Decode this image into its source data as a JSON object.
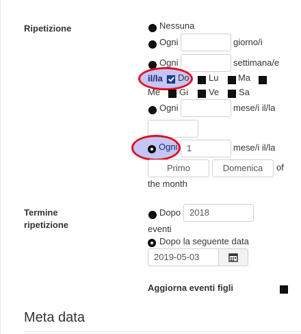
{
  "repeat": {
    "label": "Ripetizione",
    "none": "Nessuna",
    "every": "Ogni",
    "day_unit": "giorno/i",
    "week_unit": "settimana/e",
    "on_the": "il/la",
    "days": [
      "Do",
      "Lu",
      "Ma",
      "Me",
      "Gi",
      "Ve",
      "Sa"
    ],
    "month_unit": "mese/i il/la",
    "month_every_value": "1",
    "month_unit2": "mese/i il/la",
    "ordinal": "Primo",
    "weekday": "Domenica",
    "of": "of",
    "the_month": "the month"
  },
  "end": {
    "label_line1": "Termine",
    "label_line2": "ripetizione",
    "after": "Dopo",
    "after_value": "2018",
    "events": "eventi",
    "after_date": "Dopo la seguente data",
    "date_value": "2019-05-03"
  },
  "update_children": "Aggiorna eventi figli",
  "meta_title": "Meta data",
  "colors": {
    "highlight_border": "#e0101c",
    "highlight_fill": "#9696f0"
  }
}
